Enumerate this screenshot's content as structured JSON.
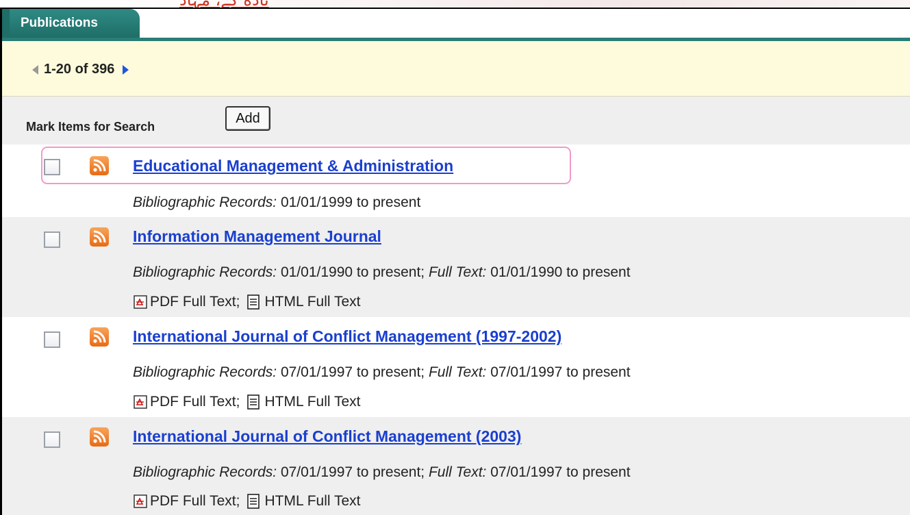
{
  "header_text": "ناده کے، مہاد",
  "tab": {
    "label": "Publications"
  },
  "pagination": {
    "label": "1-20 of 396"
  },
  "markbar": {
    "label": "Mark Items for Search",
    "add_label": "Add"
  },
  "publications": [
    {
      "title": "Educational Management & Administration",
      "bib_label": "Bibliographic Records:",
      "bib_value": "01/01/1999 to present",
      "fulltext_label": "",
      "fulltext_value": "",
      "pdf_label": "",
      "html_label": ""
    },
    {
      "title": "Information Management Journal",
      "bib_label": "Bibliographic Records:",
      "bib_value": "01/01/1990 to present;",
      "fulltext_label": "Full Text:",
      "fulltext_value": "01/01/1990 to present",
      "pdf_label": "PDF Full Text;",
      "html_label": "HTML Full Text"
    },
    {
      "title": "International Journal of Conflict Management (1997-2002)",
      "bib_label": "Bibliographic Records:",
      "bib_value": "07/01/1997 to present;",
      "fulltext_label": "Full Text:",
      "fulltext_value": "07/01/1997 to present",
      "pdf_label": "PDF Full Text;",
      "html_label": "HTML Full Text"
    },
    {
      "title": "International Journal of Conflict Management (2003)",
      "bib_label": "Bibliographic Records:",
      "bib_value": "07/01/1997 to present;",
      "fulltext_label": "Full Text:",
      "fulltext_value": "07/01/1997 to present",
      "pdf_label": "PDF Full Text;",
      "html_label": "HTML Full Text"
    }
  ],
  "colors": {
    "tab": "#2a7d76",
    "nav_bg": "#fdfbdc",
    "markbar_bg": "#efefef",
    "link": "#1a3fcf",
    "highlight": "#f09acb",
    "rss": "#e86b14"
  },
  "icons": {
    "prev": "arrow-left-icon",
    "next": "arrow-right-icon",
    "feed": "rss-icon",
    "pdf": "pdf-icon",
    "html": "html-document-icon"
  }
}
